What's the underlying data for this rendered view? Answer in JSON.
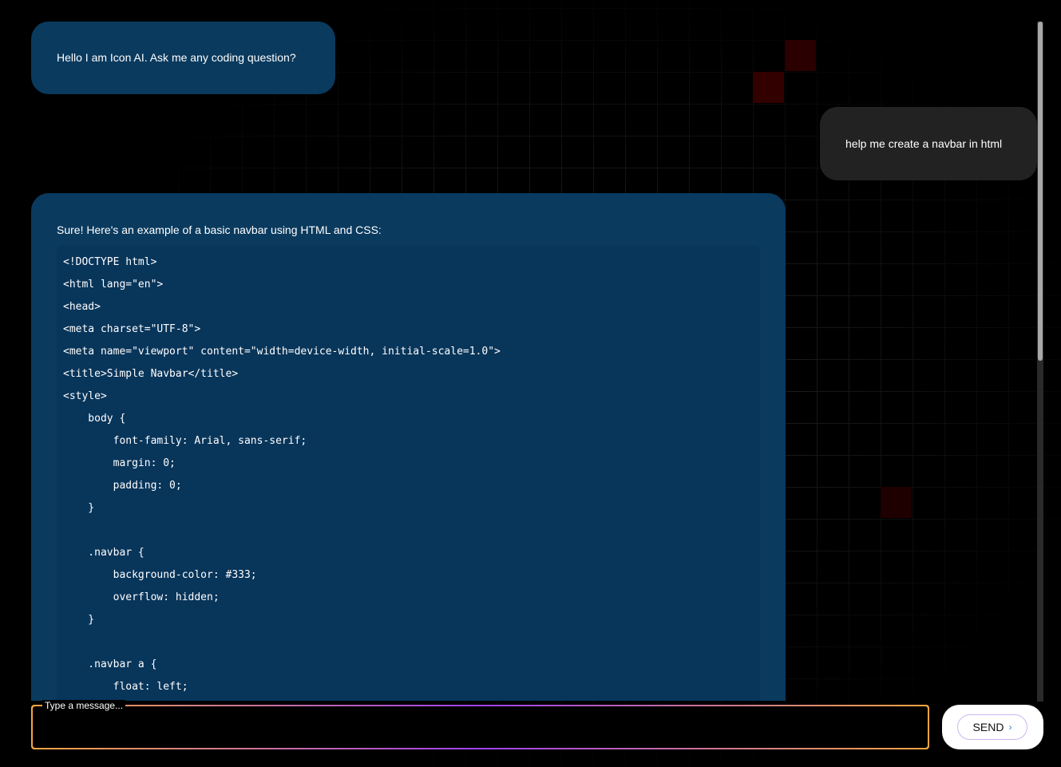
{
  "messages": [
    {
      "role": "bot",
      "text": "Hello I am Icon AI. Ask me any coding question?"
    },
    {
      "role": "user",
      "text": "help me create a navbar in html"
    },
    {
      "role": "bot",
      "text": "Sure! Here's an example of a basic navbar using HTML and CSS:",
      "code": [
        "<!DOCTYPE html>",
        "<html lang=\"en\">",
        "<head>",
        "<meta charset=\"UTF-8\">",
        "<meta name=\"viewport\" content=\"width=device-width, initial-scale=1.0\">",
        "<title>Simple Navbar</title>",
        "<style>",
        "    body {",
        "        font-family: Arial, sans-serif;",
        "        margin: 0;",
        "        padding: 0;",
        "    }",
        "",
        "    .navbar {",
        "        background-color: #333;",
        "        overflow: hidden;",
        "    }",
        "",
        "    .navbar a {",
        "        float: left;"
      ]
    }
  ],
  "input": {
    "label": "Type a message...",
    "value": ""
  },
  "send": {
    "label": "SEND",
    "icon": "chevron-right-icon"
  },
  "colors": {
    "bot_bubble": "#0a3a5e",
    "user_bubble": "#222222",
    "input_gradient": [
      "#f7a540",
      "#a040f0"
    ]
  }
}
